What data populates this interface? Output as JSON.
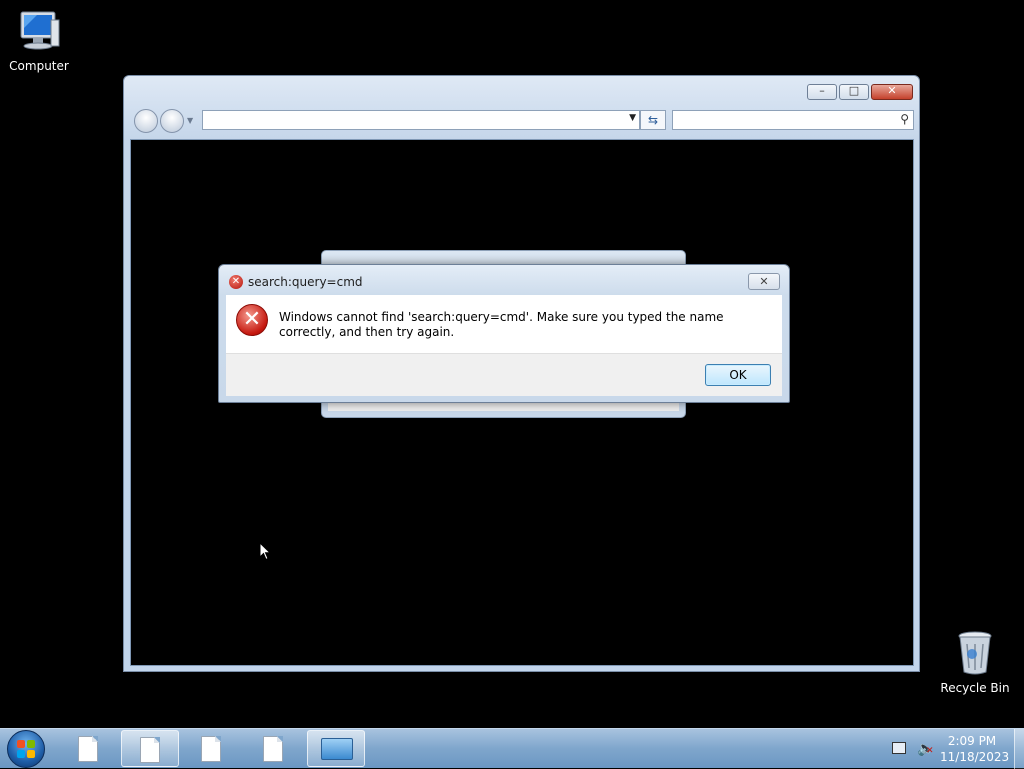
{
  "desktop": {
    "icons": [
      {
        "label": "Computer",
        "icon": "computer-icon"
      },
      {
        "label": "Recycle Bin",
        "icon": "recycle-bin-icon"
      }
    ]
  },
  "explorer": {
    "address_value": "",
    "search_placeholder": "",
    "caption_buttons": {
      "minimize": "–",
      "maximize": "□",
      "close": "✕"
    }
  },
  "dialog": {
    "title": "search:query=cmd",
    "message": "Windows cannot find 'search:query=cmd'. Make sure you typed the name correctly, and then try again.",
    "ok_label": "OK",
    "close_glyph": "✕",
    "error_glyph": "✕",
    "error_color": "#c5170e"
  },
  "taskbar": {
    "buttons": [
      {
        "icon": "document-icon",
        "active": false
      },
      {
        "icon": "document-icon",
        "active": true
      },
      {
        "icon": "document-icon",
        "active": false
      },
      {
        "icon": "document-icon",
        "active": false
      },
      {
        "icon": "control-panel-icon",
        "active": true
      }
    ],
    "clock": {
      "time": "2:09 PM",
      "date": "11/18/2023"
    }
  }
}
